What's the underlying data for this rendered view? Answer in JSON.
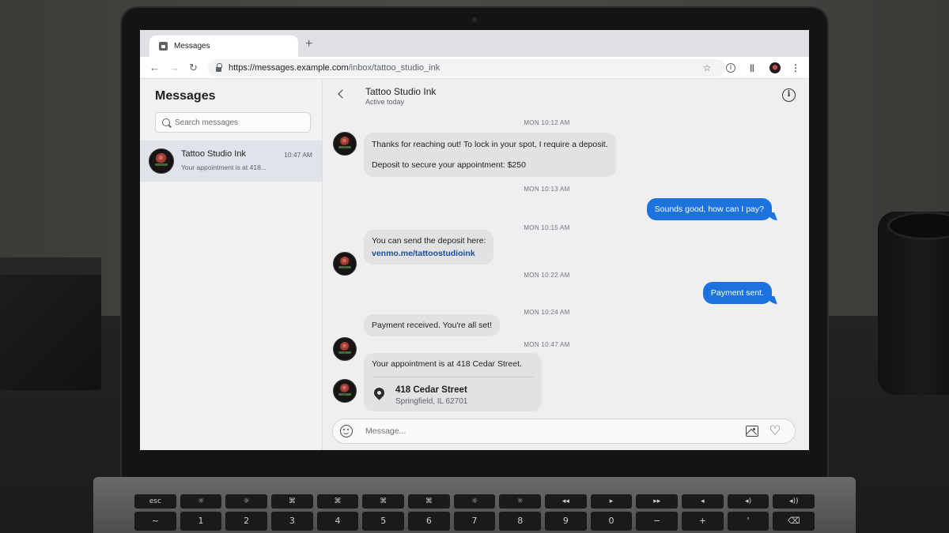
{
  "browser": {
    "tab_title": "Messages",
    "new_tab_symbol": "+",
    "url_host": "https://messages.example.com",
    "url_path": "/inbox/tattoo_studio_ink"
  },
  "sidebar": {
    "title": "Messages",
    "search_placeholder": "Search messages",
    "conversations": [
      {
        "name": "Tattoo Studio Ink",
        "time": "10:47 AM",
        "preview": "Your appointment is at 418...",
        "selected": true
      }
    ]
  },
  "chat": {
    "contact_name": "Tattoo Studio Ink",
    "status": "Active today",
    "composer_placeholder": "Message...",
    "messages": [
      {
        "timestamp": "MON 10:12 AM",
        "direction": "incoming",
        "lines": [
          "Thanks for reaching out! To lock in your spot, I require a deposit.",
          "Deposit to secure your appointment: $250"
        ]
      },
      {
        "timestamp": "MON 10:13 AM",
        "direction": "outgoing",
        "text": "Sounds good, how can I pay?"
      },
      {
        "timestamp": "MON 10:15 AM",
        "direction": "incoming",
        "text": "You can send the deposit here:",
        "link": "venmo.me/tattoostudioink"
      },
      {
        "timestamp": "MON 10:22 AM",
        "direction": "outgoing",
        "text": "Payment sent."
      },
      {
        "timestamp": "MON 10:24 AM",
        "direction": "incoming",
        "text": "Payment received. You're all set!"
      },
      {
        "timestamp": "MON 10:47 AM",
        "direction": "incoming",
        "text": "Your appointment is at 418 Cedar Street.",
        "location": {
          "street": "418 Cedar Street",
          "city": "Springfield, IL 62701"
        }
      }
    ]
  },
  "keyboard": {
    "top_row": [
      "esc",
      "☼",
      "☼",
      "⌘",
      "⌘",
      "⌘",
      "⌘",
      "☼",
      "☼",
      "◂◂",
      "▸",
      "▸▸",
      "◂",
      "◂)",
      "◂))"
    ],
    "number_row": [
      "~",
      "1",
      "2",
      "3",
      "4",
      "5",
      "6",
      "7",
      "8",
      "9",
      "0",
      "−",
      "+",
      "'",
      "⌫"
    ]
  },
  "colors": {
    "outgoing_bubble": "#1c73dd",
    "incoming_bubble": "#e2e2e5",
    "link": "#1a4fa0",
    "selected_conversation": "#dfe3ea"
  }
}
